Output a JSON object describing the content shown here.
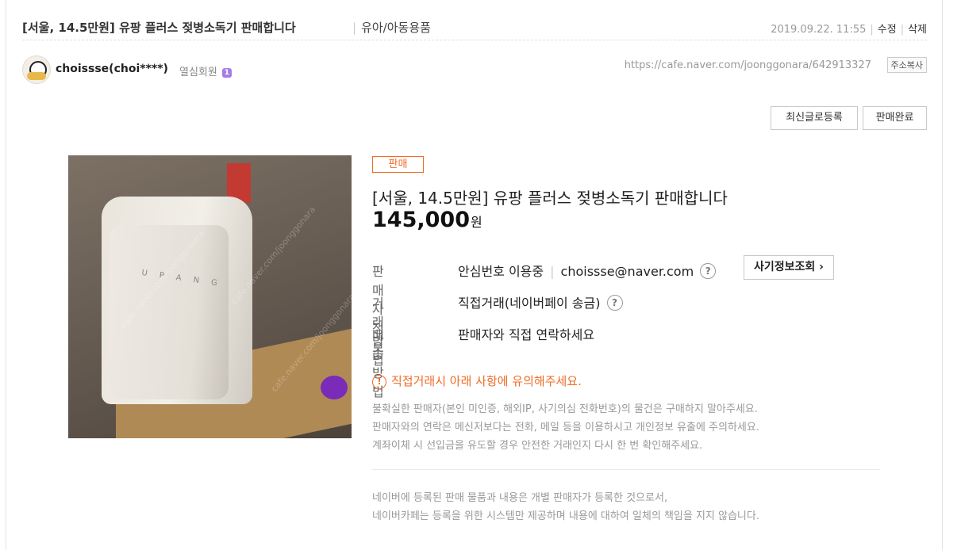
{
  "header": {
    "title": "[서울, 14.5만원] 유팡 플러스 젖병소독기 판매합니다",
    "category": "유아/아동용품",
    "date": "2019.09.22. 11:55",
    "edit": "수정",
    "delete": "삭제"
  },
  "author": {
    "nickname": "choissse(choi****)",
    "grade": "열심회원",
    "grade_badge": "1",
    "url": "https://cafe.naver.com/joonggonara/642913327",
    "copy_url": "주소복사"
  },
  "actions": {
    "repost": "최신글로등록",
    "sold": "판매완료"
  },
  "product": {
    "status_badge": "판매",
    "title": "[서울, 14.5만원] 유팡 플러스 젖병소독기 판매합니다",
    "price": "145,000",
    "price_unit": "원",
    "photo_logo": "U P A N G",
    "watermark": "cafe.naver.com/joonggonara"
  },
  "info": {
    "seller_label": "판매자정보",
    "seller_phone": "안심번호 이용중",
    "seller_email": "choissse@naver.com",
    "fraud_check": "사기정보조회",
    "trade_label": "거래방법",
    "trade_value": "직접거래(네이버페이 송금)",
    "delivery_label": "배송방법",
    "delivery_value": "판매자와 직접 연락하세요",
    "help": "?"
  },
  "warning": {
    "icon": "!",
    "title": "직접거래시 아래 사항에 유의해주세요.",
    "lines": [
      "불확실한 판매자(본인 미인증, 해외IP, 사기의심 전화번호)의 물건은 구매하지 말아주세요.",
      "판매자와의 연락은 메신저보다는 전화, 메일 등을 이용하시고 개인정보 유출에 주의하세요.",
      "계좌이체 시 선입금을 유도할 경우 안전한 거래인지 다시 한 번 확인해주세요."
    ]
  },
  "disclaimer": {
    "lines": [
      "네이버에 등록된 판매 물품과 내용은 개별 판매자가 등록한 것으로서,",
      "네이버카페는 등록을 위한 시스템만 제공하며 내용에 대하여 일체의 책임을 지지 않습니다."
    ]
  },
  "colors": {
    "accent": "#f06b26",
    "badge_purple": "#a67de6"
  }
}
